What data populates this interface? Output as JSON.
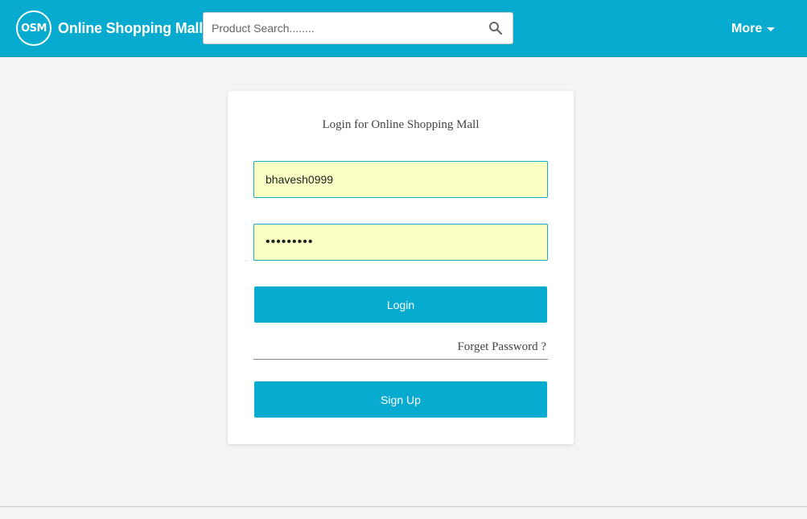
{
  "header": {
    "logo_text": "OSM",
    "brand_name": "Online Shopping Mall",
    "search_placeholder": "Product Search........",
    "search_icon": "search-icon",
    "more_label": "More",
    "more_icon": "caret-down-icon",
    "bg_color": "#06abcf"
  },
  "login": {
    "title": "Login for Online Shopping Mall",
    "username_value": "bhavesh0999",
    "password_value": "•••••••••",
    "login_label": "Login",
    "forget_label": "Forget Password ?",
    "signup_label": "Sign Up",
    "field_bg": "#fbffc3",
    "button_color": "#06abcf"
  }
}
